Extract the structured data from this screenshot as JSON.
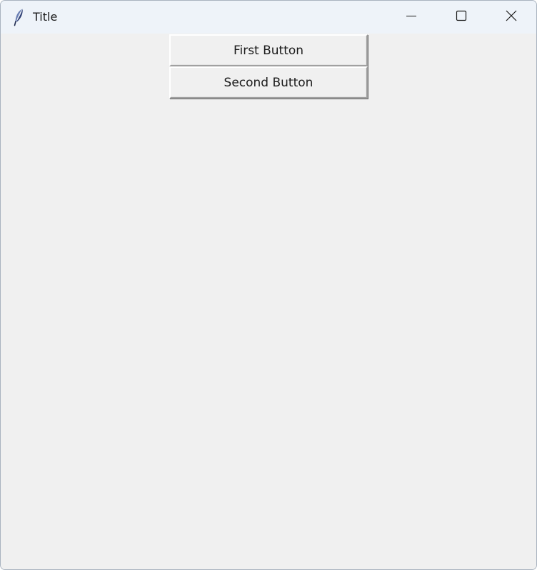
{
  "window": {
    "title": "Title",
    "icon": "feather-icon",
    "controls": {
      "minimize": "minimize-icon",
      "maximize": "maximize-icon",
      "close": "close-icon"
    }
  },
  "buttons": [
    {
      "label": "First Button"
    },
    {
      "label": "Second Button"
    }
  ],
  "colors": {
    "titlebar": "#eef3f9",
    "client_background": "#f0f0f0"
  }
}
